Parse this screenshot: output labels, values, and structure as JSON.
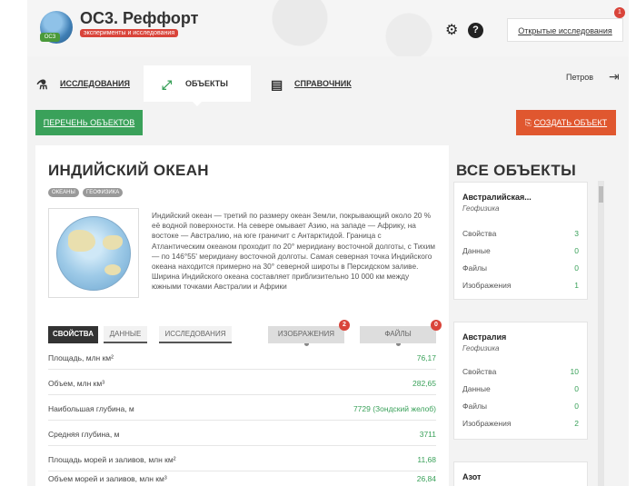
{
  "header": {
    "app_title": "ОС3. Реффорт",
    "app_subtitle": "эксперименты и исследования",
    "logo_badge": "ОСЗ",
    "open_research_label": "Открытые исследования",
    "open_research_count": "1"
  },
  "nav": {
    "research": "ИССЛЕДОВАНИЯ",
    "objects": "ОБЪЕКТЫ",
    "reference": "СПРАВОЧНИК",
    "user": "Петров"
  },
  "actions": {
    "list_objects": "ПЕРЕЧЕНЬ ОБЪЕКТОВ",
    "create_object": "СОЗДАТЬ ОБЪЕКТ"
  },
  "object": {
    "title": "ИНДИЙСКИЙ ОКЕАН",
    "tags": [
      "ОКЕАНЫ",
      "ГЕОФИЗИКА"
    ],
    "description": "Индийский океан — третий по размеру океан Земли, покрывающий около 20 % её водной поверхности. На севере омывает Азию, на западе — Африку, на востоке — Австралию, на юге граничит с Антарктидой. Граница с Атлантическим океаном проходит по 20° меридиану восточной долготы, с Тихим — по 146°55' меридиану восточной долготы. Самая северная точка Индийского океана находится примерно на 30° северной широты в Персидском заливе. Ширина Индийского океана составляет приблизительно 10 000 км между южными точками Австралии и Африки"
  },
  "tabs": {
    "properties": "СВОЙСТВА",
    "data": "ДАННЫЕ",
    "research": "ИССЛЕДОВАНИЯ",
    "images": "ИЗОБРАЖЕНИЯ",
    "images_count": "2",
    "files": "ФАЙЛЫ",
    "files_count": "0"
  },
  "properties": [
    {
      "name": "Площадь, млн км²",
      "value": "76,17"
    },
    {
      "name": "Объем, млн км³",
      "value": "282,65"
    },
    {
      "name": "Наибольшая глубина, м",
      "value": "7729 (Зондский желоб)"
    },
    {
      "name": "Средняя глубина, м",
      "value": "3711"
    },
    {
      "name": "Площадь морей и заливов, млн км²",
      "value": "11,68"
    },
    {
      "name": "Объем морей и заливов, млн км³",
      "value": "26,84"
    }
  ],
  "all_objects": {
    "title": "ВСЕ ОБЪЕКТЫ",
    "cards": [
      {
        "title": "Австралийская...",
        "subtitle": "Геофизика",
        "rows": [
          {
            "label": "Свойства",
            "value": "3"
          },
          {
            "label": "Данные",
            "value": "0"
          },
          {
            "label": "Файлы",
            "value": "0"
          },
          {
            "label": "Изображения",
            "value": "1"
          }
        ]
      },
      {
        "title": "Австралия",
        "subtitle": "Геофизика",
        "rows": [
          {
            "label": "Свойства",
            "value": "10"
          },
          {
            "label": "Данные",
            "value": "0"
          },
          {
            "label": "Файлы",
            "value": "0"
          },
          {
            "label": "Изображения",
            "value": "2"
          }
        ]
      },
      {
        "title": "Азот",
        "subtitle": "",
        "rows": []
      }
    ]
  }
}
